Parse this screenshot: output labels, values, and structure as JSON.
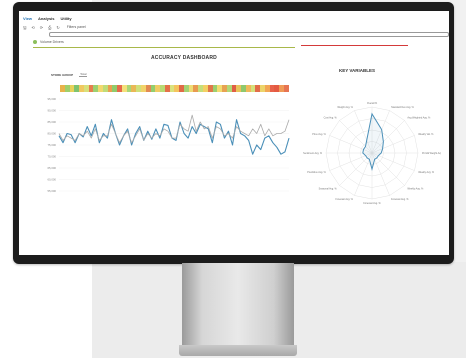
{
  "menu": {
    "items": [
      "View",
      "Analysis",
      "Utility"
    ],
    "active_index": 0
  },
  "toolbar": {
    "buttons": [
      {
        "name": "save-icon",
        "glyph": "🖫"
      },
      {
        "name": "undo-icon",
        "glyph": "⟲"
      },
      {
        "name": "redo-icon",
        "glyph": "⟳"
      },
      {
        "name": "print-icon",
        "glyph": "⎙"
      },
      {
        "name": "refresh-icon",
        "glyph": "↻"
      }
    ],
    "label": "Filters panel"
  },
  "breadcrumb": {
    "text": "Volume Drivers"
  },
  "dashboard": {
    "title": "ACCURACY DASHBOARD",
    "filter_label": "STORE GROUP",
    "filter_value": "Total",
    "heat_colors": [
      "#e8b24a",
      "#9fcf6a",
      "#e8d25a",
      "#7fc36e",
      "#f0c860",
      "#d8e07a",
      "#e67e4e",
      "#9cd070",
      "#f2d86e",
      "#bfdc78",
      "#e9a050",
      "#8fcb6b",
      "#e66a4a",
      "#f4e07a",
      "#aad676",
      "#e9b856",
      "#cfe07a",
      "#f1d36a",
      "#e28a52",
      "#92ce6e",
      "#f0cc64",
      "#b8da74",
      "#e47048",
      "#d9e27e",
      "#f4c45e",
      "#e06a46",
      "#a4d274",
      "#eedc74",
      "#e89a50",
      "#c4de7a",
      "#f2d064",
      "#e0784a",
      "#9ccf70",
      "#f3dc70",
      "#e7a252",
      "#b2d876",
      "#e05e44",
      "#e8c45a",
      "#8ec86c",
      "#f0b85a",
      "#d4e07c",
      "#e26c48",
      "#ecd46a",
      "#f2a654",
      "#e8624a",
      "#e45a42",
      "#f09a56",
      "#e67452"
    ],
    "chart_data": {
      "type": "line",
      "y_tick_labels": [
        "95,000",
        "90,000",
        "85,000",
        "80,000",
        "75,000",
        "70,000",
        "65,000",
        "60,000",
        "55,000"
      ],
      "ylim": [
        55000,
        95000
      ],
      "series": [
        {
          "color": "#4a8fb8",
          "values": [
            79000,
            76000,
            80000,
            79500,
            76000,
            80000,
            78500,
            83000,
            79000,
            84000,
            76000,
            80000,
            78000,
            86000,
            80000,
            75000,
            79000,
            82000,
            75000,
            80000,
            83000,
            77000,
            81000,
            77500,
            82000,
            78000,
            84000,
            83500,
            78000,
            77000,
            85000,
            80000,
            78000,
            83000,
            80000,
            84000,
            83000,
            82000,
            76000,
            85000,
            84000,
            78000,
            81000,
            75000,
            86000,
            80000,
            79000,
            77000,
            71000,
            75000,
            73000,
            78000,
            79000,
            76000,
            74000,
            71000,
            72000,
            78000
          ]
        },
        {
          "color": "#aaaaaa",
          "values": [
            80000,
            77000,
            79000,
            78000,
            77000,
            80000,
            79000,
            81000,
            78000,
            82000,
            77000,
            79000,
            79000,
            84000,
            80000,
            76000,
            79000,
            81000,
            76000,
            79000,
            82000,
            77000,
            80000,
            78000,
            80000,
            79000,
            82000,
            81000,
            78000,
            78000,
            84000,
            82000,
            81000,
            88000,
            81000,
            85000,
            82000,
            83000,
            78000,
            83000,
            82000,
            79000,
            80000,
            78000,
            83000,
            81000,
            80000,
            79000,
            82000,
            80000,
            84000,
            79000,
            82000,
            79000,
            80000,
            80000,
            81000,
            86000
          ]
        }
      ]
    }
  },
  "key_variables": {
    "title": "KEY VARIABLES",
    "radar": {
      "axes": [
        "Overall %",
        "Standard Dev Avg. %",
        "Avg Weighted Avg. %",
        "Weekly Val. %",
        "ProVal Weight Avg. %",
        "Weekly Avg. %",
        "Weekly Avg. %",
        "Forecast Avg. %",
        "Forecast Avg. %",
        "Forecast Avg. %",
        "Seasonal Avg. %",
        "Predictive Avg. %",
        "Customer Sentiment Avg. %",
        "Price Avg. %",
        "Cost Avg. %",
        "Weight Avg. %"
      ],
      "values": [
        0.85,
        0.55,
        0.35,
        0.25,
        0.2,
        0.15,
        0.15,
        0.15,
        0.35,
        0.15,
        0.15,
        0.15,
        0.2,
        0.2,
        0.2,
        0.3
      ],
      "color": "#4a8fb8"
    }
  }
}
